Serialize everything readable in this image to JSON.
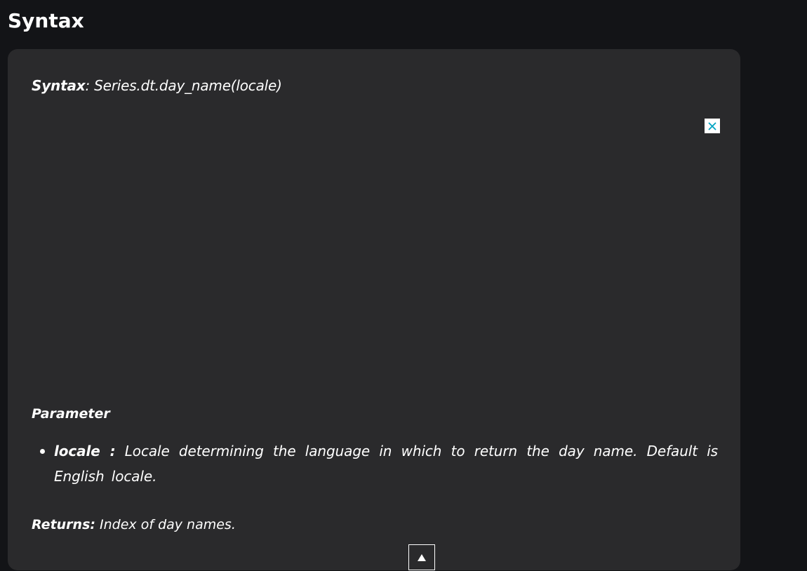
{
  "page": {
    "heading": "Syntax"
  },
  "syntax": {
    "label": "Syntax",
    "value": ": Series.dt.day_name(locale)"
  },
  "ad": {
    "close_icon": "close-x-icon",
    "close_color": "#00a3c2"
  },
  "parameter": {
    "heading": "Parameter",
    "items": [
      {
        "name": "locale :",
        "description": "Locale determining the language in which to return the day name. Default is English locale."
      }
    ]
  },
  "returns": {
    "label": "Returns:",
    "value": "Index of day names."
  },
  "scroll_top": {
    "icon": "triangle-up-icon"
  },
  "colors": {
    "page_background": "#131417",
    "card_background": "#2a2a2c",
    "text": "#ffffff"
  }
}
